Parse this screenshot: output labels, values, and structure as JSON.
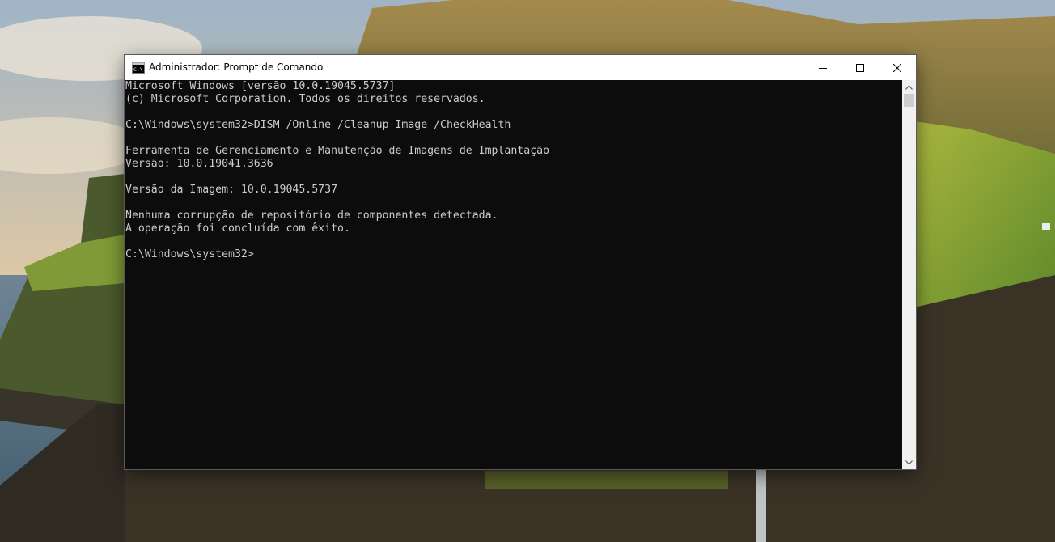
{
  "window": {
    "title": "Administrador: Prompt de Comando",
    "app_icon": "cmd-icon",
    "buttons": {
      "minimize": "minimize-icon",
      "maximize": "maximize-icon",
      "close": "close-icon"
    }
  },
  "console": {
    "lines": [
      "Microsoft Windows [versão 10.0.19045.5737]",
      "(c) Microsoft Corporation. Todos os direitos reservados.",
      "",
      "C:\\Windows\\system32>DISM /Online /Cleanup-Image /CheckHealth",
      "",
      "Ferramenta de Gerenciamento e Manutenção de Imagens de Implantação",
      "Versão: 10.0.19041.3636",
      "",
      "Versão da Imagem: 10.0.19045.5737",
      "",
      "Nenhuma corrupção de repositório de componentes detectada.",
      "A operação foi concluída com êxito.",
      "",
      "C:\\Windows\\system32>"
    ],
    "colors": {
      "background": "#0c0c0c",
      "text": "#cccccc"
    }
  },
  "scrollbar": {
    "up_icon": "scroll-up-arrow-icon",
    "down_icon": "scroll-down-arrow-icon"
  }
}
